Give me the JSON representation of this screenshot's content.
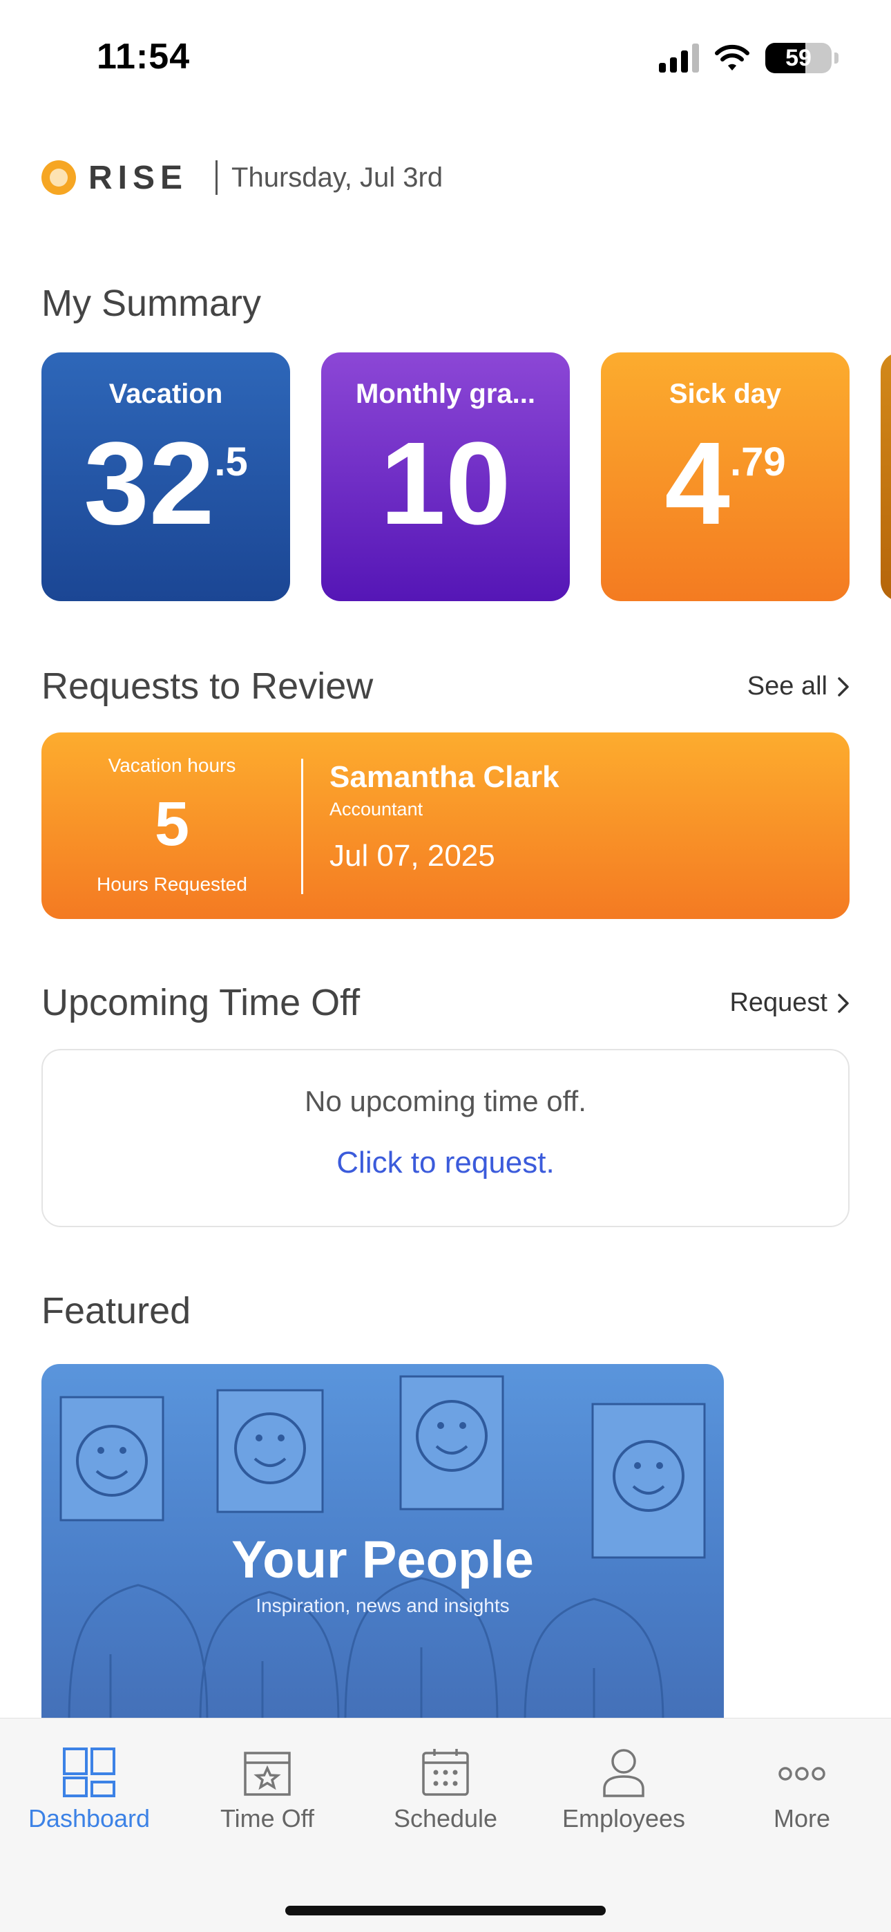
{
  "status_bar": {
    "time": "11:54",
    "battery": "59"
  },
  "header": {
    "brand": "RISE",
    "date": "Thursday, Jul 3rd"
  },
  "summary": {
    "title": "My Summary",
    "cards": [
      {
        "label": "Vacation",
        "whole": "32",
        "fraction": ".5"
      },
      {
        "label": "Monthly gra...",
        "whole": "10",
        "fraction": ""
      },
      {
        "label": "Sick day",
        "whole": "4",
        "fraction": ".79"
      }
    ]
  },
  "requests": {
    "title": "Requests to Review",
    "link": "See all",
    "item": {
      "type": "Vacation hours",
      "amount": "5",
      "unit": "Hours Requested",
      "name": "Samantha Clark",
      "role": "Accountant",
      "date": "Jul 07, 2025"
    }
  },
  "upcoming": {
    "title": "Upcoming Time Off",
    "link": "Request",
    "empty_text": "No upcoming time off.",
    "cta": "Click to request."
  },
  "featured": {
    "title": "Featured",
    "card_title": "Your People",
    "card_subtitle": "Inspiration, news and insights"
  },
  "tabs": [
    {
      "label": "Dashboard",
      "icon": "dashboard-icon",
      "active": true
    },
    {
      "label": "Time Off",
      "icon": "calendar-star-icon",
      "active": false
    },
    {
      "label": "Schedule",
      "icon": "calendar-grid-icon",
      "active": false
    },
    {
      "label": "Employees",
      "icon": "person-icon",
      "active": false
    },
    {
      "label": "More",
      "icon": "more-dots-icon",
      "active": false
    }
  ],
  "colors": {
    "accent": "#3c82e6",
    "vacation": "#1f4d9c",
    "monthly": "#6a22c8",
    "sick": "#f58a24",
    "link": "#3b5bdb"
  }
}
